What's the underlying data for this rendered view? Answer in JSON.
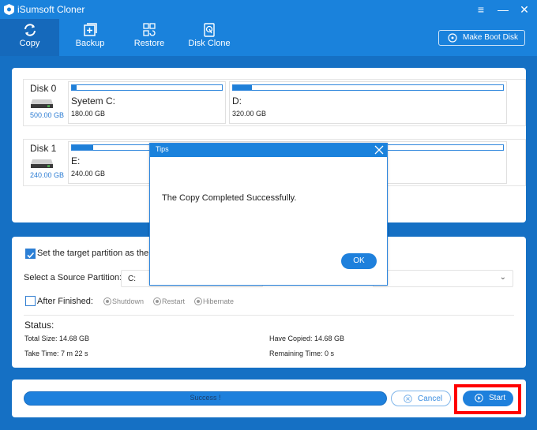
{
  "app": {
    "title": "iSumsoft Cloner",
    "window_controls": {
      "menu": "≡",
      "minimize": "—",
      "close": "✕"
    }
  },
  "toolbar": {
    "tabs": [
      {
        "label": "Copy",
        "icon": "refresh-icon",
        "active": true
      },
      {
        "label": "Backup",
        "icon": "backup-icon",
        "active": false
      },
      {
        "label": "Restore",
        "icon": "restore-icon",
        "active": false
      },
      {
        "label": "Disk Clone",
        "icon": "disk-clone-icon",
        "active": false
      }
    ],
    "boot_button": {
      "label": "Make Boot Disk",
      "icon": "disc-icon"
    }
  },
  "disks": [
    {
      "name": "Disk 0",
      "size": "500.00 GB",
      "partitions": [
        {
          "label": "Syetem C:",
          "size": "180.00 GB",
          "used_fraction": 0.03
        },
        {
          "label": "D:",
          "size": "320.00 GB",
          "used_fraction": 0.07
        }
      ]
    },
    {
      "name": "Disk 1",
      "size": "240.00 GB",
      "partitions": [
        {
          "label": "E:",
          "size": "240.00 GB",
          "used_fraction": 0.05
        }
      ]
    }
  ],
  "options": {
    "set_target_boot": {
      "label": "Set the target partition as the b",
      "checked": true
    },
    "source_partition": {
      "label": "Select a Source Partition:",
      "value": "C:"
    },
    "target_select": {
      "value": ""
    },
    "after_finished": {
      "label": "After Finished:",
      "checked": false,
      "choices": [
        "Shutdown",
        "Restart",
        "Hibernate"
      ]
    }
  },
  "status": {
    "title": "Status:",
    "total_size": "Total Size: 14.68 GB",
    "take_time": "Take Time: 7 m 22 s",
    "have_copied": "Have Copied: 14.68 GB",
    "remaining_time": "Remaining Time: 0 s"
  },
  "actions": {
    "progress_text": "Success !",
    "progress_percent": 100,
    "cancel_label": "Cancel",
    "start_label": "Start"
  },
  "dialog": {
    "title": "Tips",
    "message": "The Copy Completed Successfully.",
    "ok_label": "OK"
  },
  "colors": {
    "primary": "#1a82dc",
    "background": "#1570c4",
    "highlight": "#ff0000"
  }
}
